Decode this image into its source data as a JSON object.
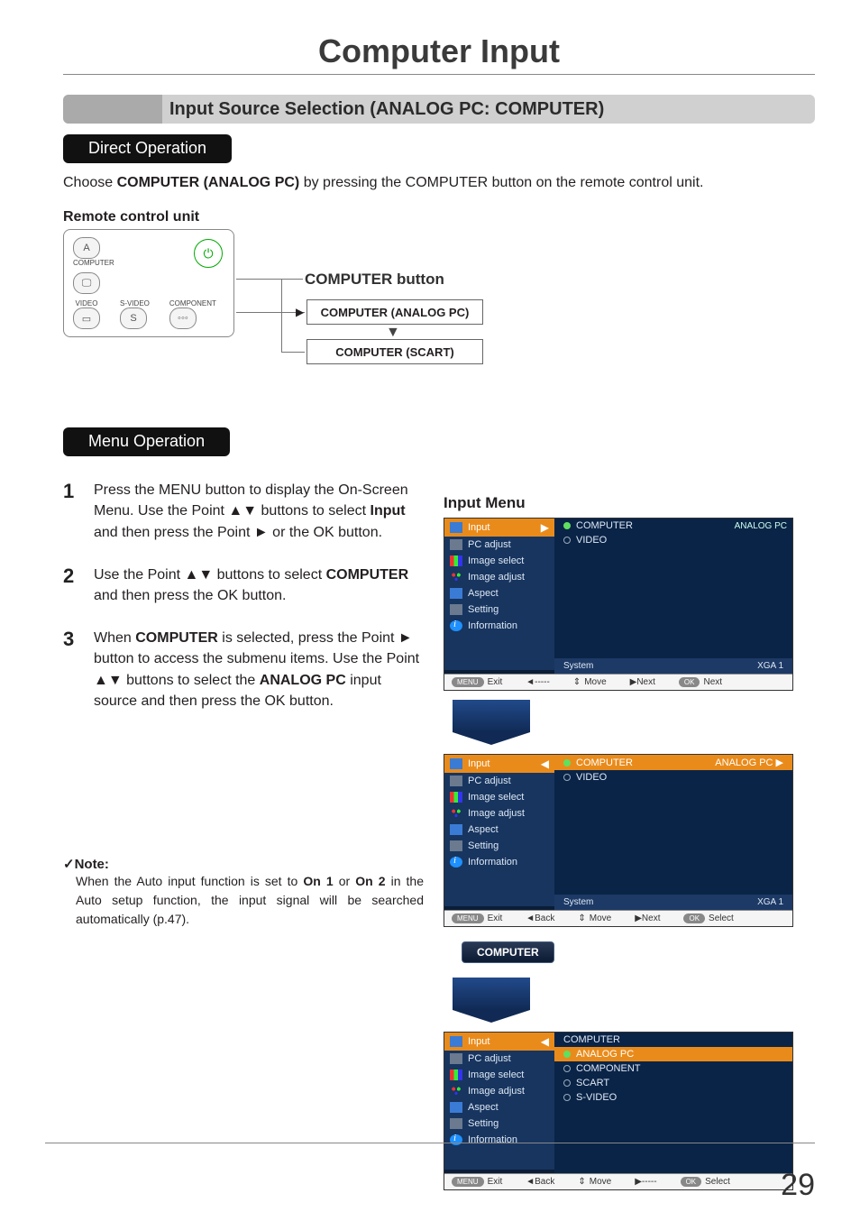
{
  "page": {
    "chapter_title": "Computer Input",
    "section_header": "Input Source Selection (ANALOG PC: COMPUTER)",
    "direct_op_label": "Direct Operation",
    "direct_op_text_pre": "Choose ",
    "direct_op_bold": "COMPUTER (ANALOG PC)",
    "direct_op_text_post": " by pressing the COMPUTER button on the remote control unit.",
    "rc_title": "Remote control unit",
    "rc": {
      "computer_label": "COMPUTER",
      "video": "VIDEO",
      "svideo": "S-VIDEO",
      "component": "COMPONENT"
    },
    "computer_button_title": "COMPUTER button",
    "flow1": "COMPUTER (ANALOG PC)",
    "flow2": "COMPUTER (SCART)",
    "menu_op_label": "Menu Operation",
    "steps": [
      {
        "n": "1",
        "pre": "Press the MENU button to display the On-Screen Menu. Use the Point ▲▼ buttons to select ",
        "b": "Input",
        "post": " and then press the Point ► or the OK button."
      },
      {
        "n": "2",
        "pre": "Use the Point ▲▼ buttons to select ",
        "b": "COMPUTER",
        "post": " and then press the OK button."
      },
      {
        "n": "3",
        "pre": "When ",
        "b": "COMPUTER",
        "post": " is selected, press the Point ► button to access the submenu items. Use the Point ▲▼ buttons to select the ",
        "b2": "ANALOG PC",
        "post2": " input source and then press the OK button."
      }
    ],
    "note": {
      "title": "✓Note:",
      "text_pre": "When the Auto input function is set to ",
      "b1": "On 1",
      "mid": " or ",
      "b2": "On 2",
      "text_post": " in the Auto setup function, the input signal will be searched automatically (p.47)."
    },
    "input_menu_title": "Input Menu",
    "side_items": [
      "Input",
      "PC adjust",
      "Image select",
      "Image adjust",
      "Aspect",
      "Setting",
      "Information"
    ],
    "osd1": {
      "main_items": [
        "COMPUTER",
        "VIDEO"
      ],
      "right_tag": "ANALOG PC",
      "system": "System",
      "system_val": "XGA 1",
      "bb": [
        "Exit",
        "◄-----",
        "Move",
        "▶Next",
        "Next"
      ],
      "menu_pill": "MENU",
      "ok_pill": "OK"
    },
    "osd2": {
      "main_items": [
        "COMPUTER",
        "VIDEO"
      ],
      "right_tag": "ANALOG PC  ▶",
      "system": "System",
      "system_val": "XGA 1",
      "bb": [
        "Exit",
        "◄Back",
        "Move",
        "▶Next",
        "Select"
      ]
    },
    "computer_tag": "COMPUTER",
    "osd3": {
      "main_items": [
        "COMPUTER",
        "ANALOG PC",
        "COMPONENT",
        "SCART",
        "S-VIDEO"
      ],
      "bb": [
        "Exit",
        "◄Back",
        "Move",
        "▶-----",
        "Select"
      ]
    },
    "page_number": "29"
  }
}
